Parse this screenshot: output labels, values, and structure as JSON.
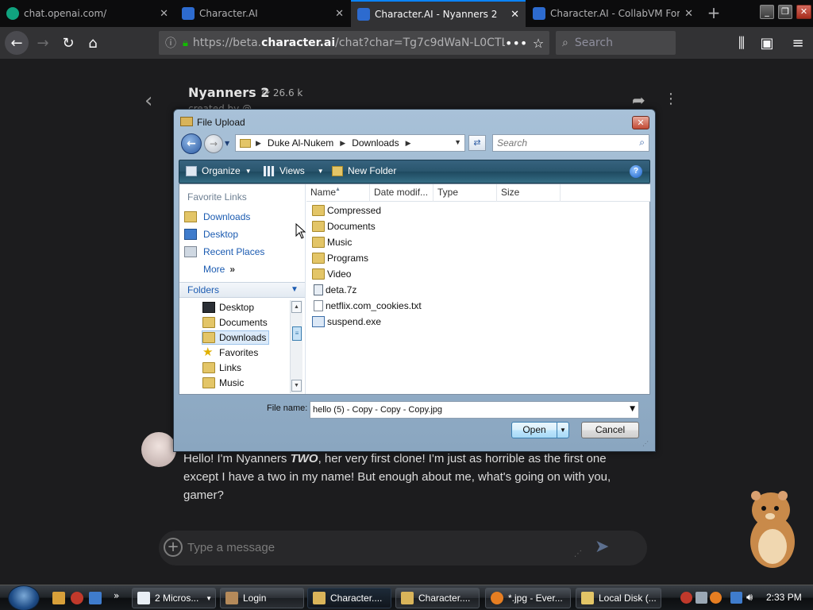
{
  "browser": {
    "tabs": [
      {
        "title": "chat.openai.com/",
        "icon": "chatgpt-icon",
        "active": false
      },
      {
        "title": "Character.AI",
        "icon": "character-ai-icon",
        "active": false
      },
      {
        "title": "Character.AI - Nyanners 2",
        "icon": "character-ai-icon",
        "active": true
      },
      {
        "title": "Character.AI - CollabVM Fork",
        "icon": "character-ai-icon",
        "active": false
      }
    ],
    "url_prefix": "https://beta.",
    "url_domain": "character.ai",
    "url_rest": "/chat?char=Tg7c9dWaN-L0CTLII...",
    "search_placeholder": "Search"
  },
  "chat": {
    "bot_name": "Nyanners 2",
    "interaction_count": "26.6 k",
    "creator": "created by @...",
    "message_before": "Hello! I'm Nyanners ",
    "message_emph": "TWO",
    "message_after": ", her very first clone! I'm just as horrible as the first one except I have a two in my name! But enough about me, what's going on with you, gamer?",
    "input_placeholder": "Type a message"
  },
  "dialog": {
    "title": "File Upload",
    "breadcrumb": [
      "Duke Al-Nukem",
      "Downloads"
    ],
    "search_placeholder": "Search",
    "toolbar": {
      "organize": "Organize",
      "views": "Views",
      "new_folder": "New Folder"
    },
    "favorite_links_header": "Favorite Links",
    "favorite_links": [
      "Downloads",
      "Desktop",
      "Recent Places",
      "More"
    ],
    "folders_header": "Folders",
    "folder_tree": [
      {
        "label": "Desktop",
        "selected": false
      },
      {
        "label": "Documents",
        "selected": false
      },
      {
        "label": "Downloads",
        "selected": true
      },
      {
        "label": "Favorites",
        "selected": false
      },
      {
        "label": "Links",
        "selected": false
      },
      {
        "label": "Music",
        "selected": false
      }
    ],
    "columns": [
      "Name",
      "Date modif...",
      "Type",
      "Size"
    ],
    "files": [
      {
        "name": "Compressed",
        "kind": "folder"
      },
      {
        "name": "Documents",
        "kind": "folder"
      },
      {
        "name": "Music",
        "kind": "folder"
      },
      {
        "name": "Programs",
        "kind": "folder"
      },
      {
        "name": "Video",
        "kind": "folder"
      },
      {
        "name": "deta.7z",
        "kind": "archive"
      },
      {
        "name": "netflix.com_cookies.txt",
        "kind": "text"
      },
      {
        "name": "suspend.exe",
        "kind": "executable"
      }
    ],
    "file_name_label": "File name:",
    "file_name_value": "hello (5) - Copy - Copy - Copy.jpg",
    "open_label": "Open",
    "cancel_label": "Cancel"
  },
  "taskbar": {
    "buttons": [
      {
        "label": "2 Micros...",
        "active": false
      },
      {
        "label": "Login",
        "active": false
      },
      {
        "label": "Character....",
        "active": true
      },
      {
        "label": "Character....",
        "active": false
      },
      {
        "label": "*.jpg - Ever...",
        "active": false
      },
      {
        "label": "Local Disk (...",
        "active": false
      }
    ],
    "clock": "2:33 PM"
  },
  "colors": {
    "accent_tab": "#0a84ff",
    "page_bg": "#1c1c1e",
    "dialog_frame": "#8aa6c0",
    "link_blue": "#1b5bb1"
  }
}
